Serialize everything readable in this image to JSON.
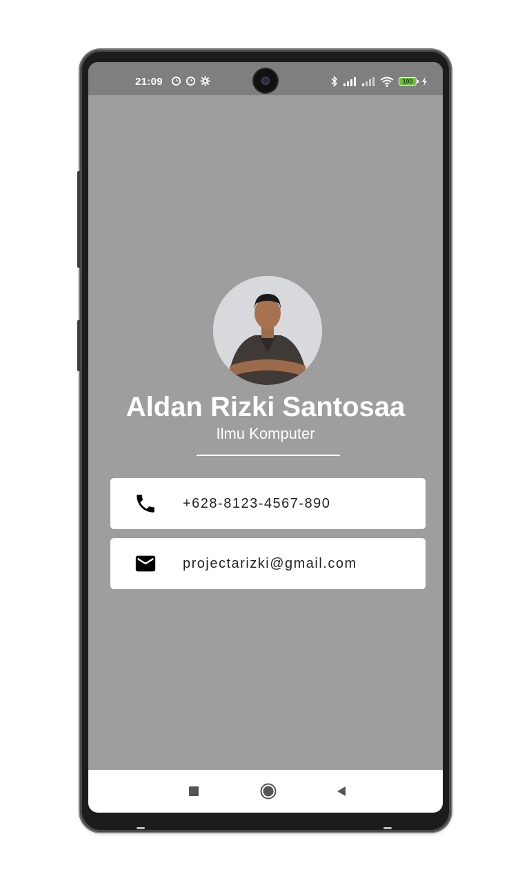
{
  "status_bar": {
    "time": "21:09",
    "battery": "100",
    "left_icons": [
      "sync-icon",
      "sync-icon",
      "settings-icon"
    ],
    "right_icons": [
      "bluetooth-icon",
      "signal-icon",
      "signal-weak-icon",
      "wifi-icon",
      "battery-icon",
      "charging-icon"
    ]
  },
  "profile": {
    "name": "Aldan Rizki Santosaa",
    "subtitle": "Ilmu Komputer",
    "avatar_icon": "profile-photo"
  },
  "contacts": [
    {
      "icon": "phone-icon",
      "value": "+628-8123-4567-890"
    },
    {
      "icon": "mail-icon",
      "value": "projectarizki@gmail.com"
    }
  ],
  "nav_bar": {
    "buttons": [
      "recent-apps-icon",
      "home-icon",
      "back-icon"
    ]
  },
  "colors": {
    "screen_background": "#9e9e9e",
    "status_bar": "#7f7f7f",
    "card_background": "#ffffff",
    "text_light": "#ffffff",
    "text_dark": "#222222",
    "battery": "#6ebf3b"
  }
}
